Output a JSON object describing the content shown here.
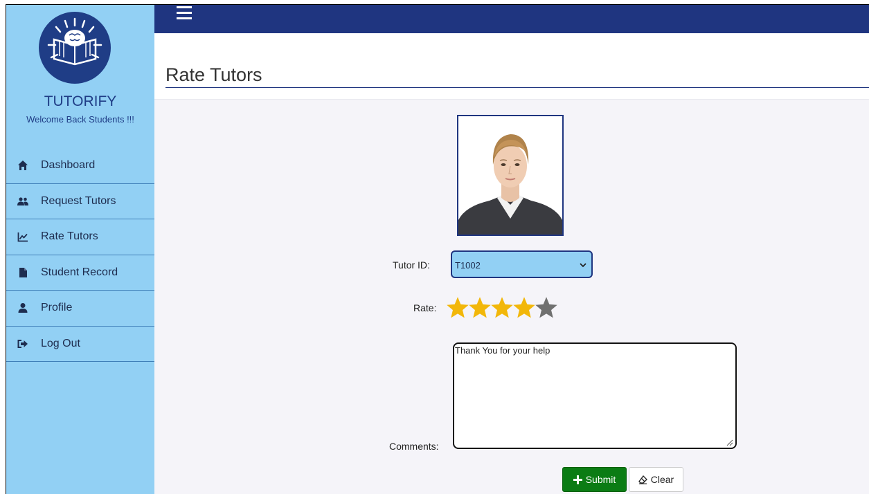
{
  "sidebar": {
    "brand": "TUTORIFY",
    "welcome": "Welcome Back Students !!!",
    "items": [
      {
        "label": "Dashboard",
        "icon": "home-icon"
      },
      {
        "label": "Request Tutors",
        "icon": "users-icon"
      },
      {
        "label": "Rate Tutors",
        "icon": "chart-line-icon"
      },
      {
        "label": "Student Record",
        "icon": "file-icon"
      },
      {
        "label": "Profile",
        "icon": "user-icon"
      },
      {
        "label": "Log Out",
        "icon": "sign-out-icon"
      }
    ]
  },
  "header": {
    "title": "Rate Tutors"
  },
  "form": {
    "tutor_id_label": "Tutor ID:",
    "tutor_id_value": "T1002",
    "rate_label": "Rate:",
    "rating": 4,
    "rating_max": 5,
    "comments_label": "Comments:",
    "comments_value": "Thank You for your help",
    "submit_label": "Submit",
    "clear_label": "Clear"
  },
  "colors": {
    "sidebar": "#92d0f4",
    "topbar": "#1f3580",
    "star_active": "#f2b70a",
    "star_inactive": "#707070",
    "submit": "#0b7c14"
  }
}
